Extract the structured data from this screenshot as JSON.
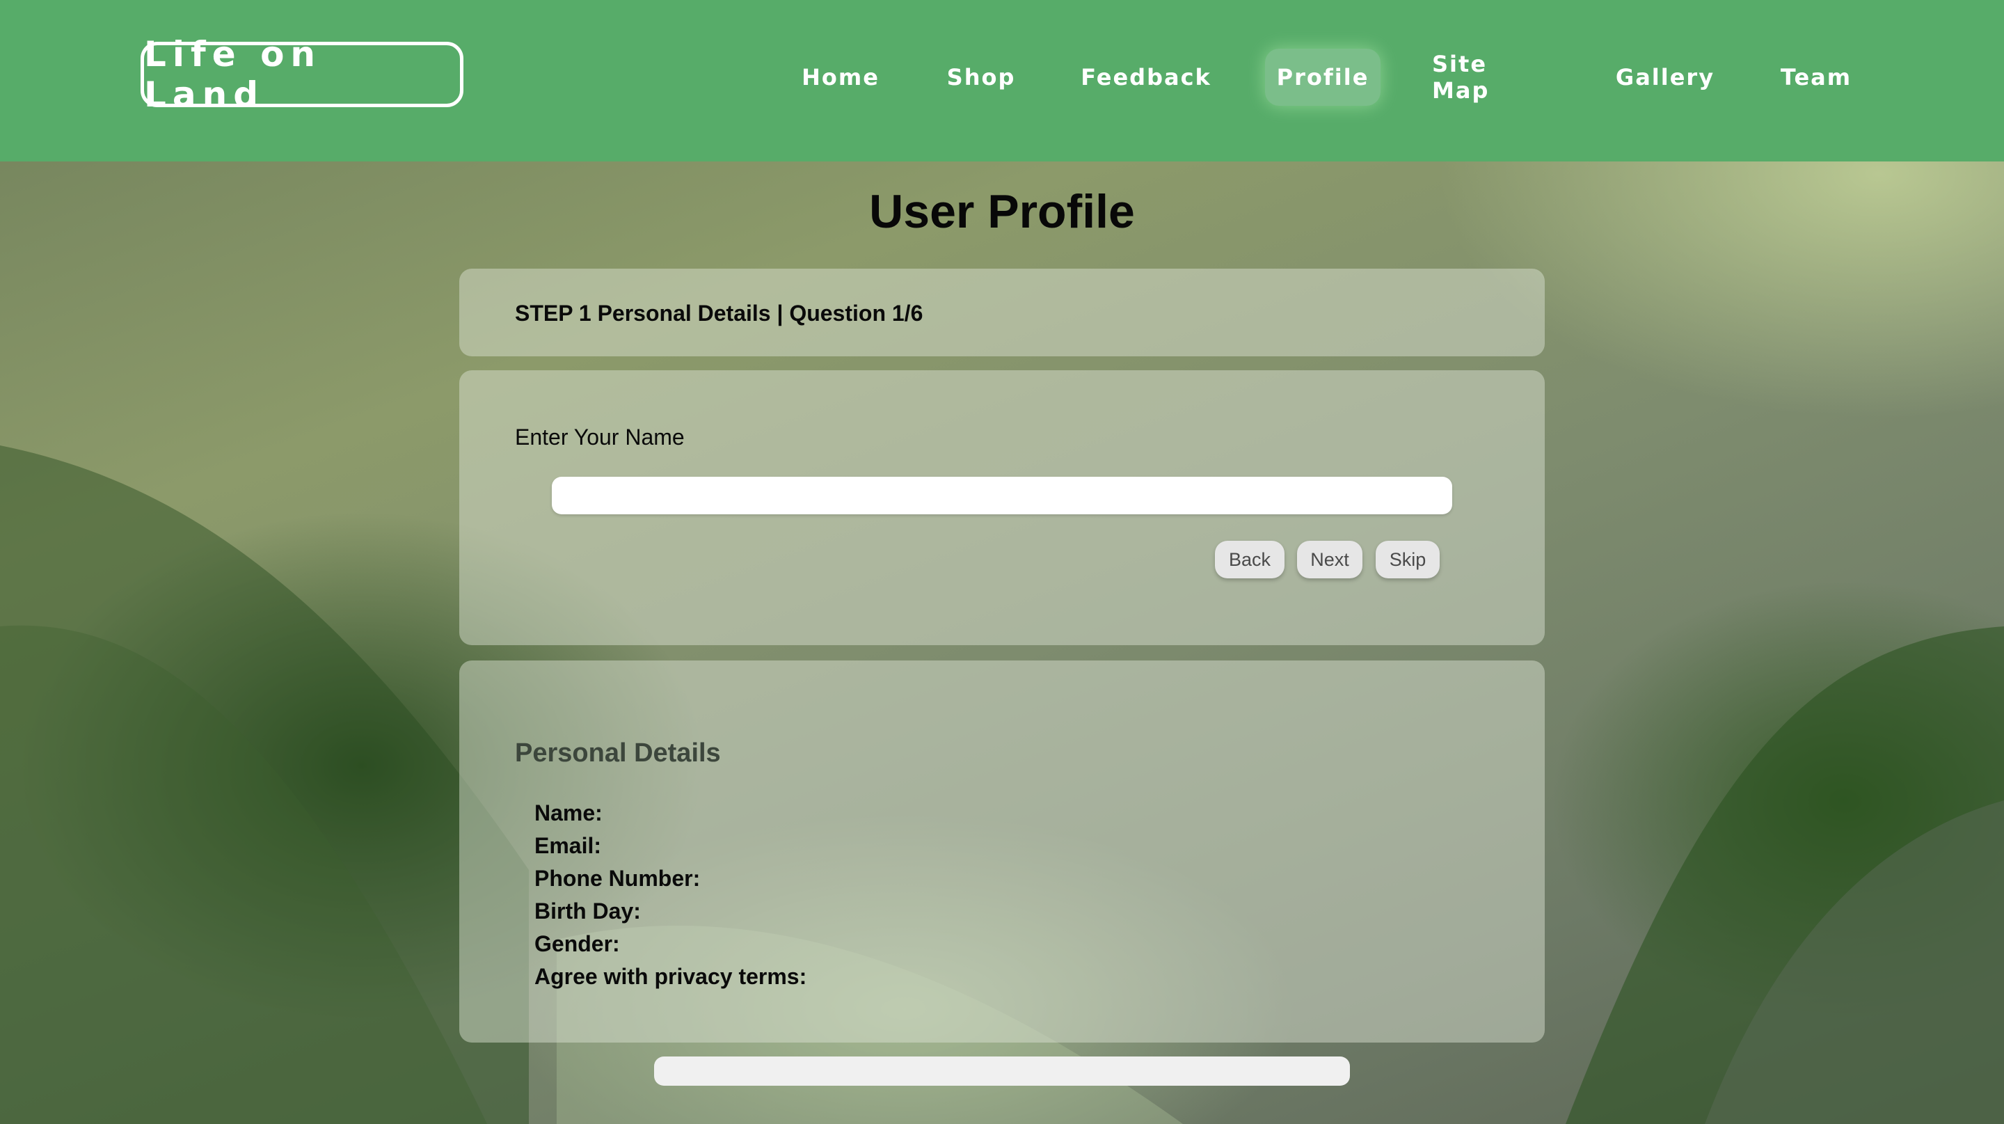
{
  "header": {
    "logo": "Life on Land",
    "nav": [
      {
        "label": "Home"
      },
      {
        "label": "Shop"
      },
      {
        "label": "Feedback"
      },
      {
        "label": "Profile",
        "active": true
      },
      {
        "label": "Site Map"
      },
      {
        "label": "Gallery"
      },
      {
        "label": "Team"
      }
    ]
  },
  "main": {
    "title": "User Profile",
    "step": {
      "text": "STEP 1 Personal Details | Question 1/6"
    },
    "question": {
      "label": "Enter Your Name",
      "input_value": "",
      "buttons": {
        "back": "Back",
        "next": "Next",
        "skip": "Skip"
      }
    },
    "details": {
      "heading": "Personal Details",
      "fields": [
        "Name:",
        "Email:",
        "Phone Number:",
        "Birth Day:",
        "Gender:",
        "Agree with privacy terms:"
      ]
    }
  },
  "colors": {
    "header_bg": "#57ac69",
    "panel_bg": "rgba(220,225,212,0.48)"
  }
}
